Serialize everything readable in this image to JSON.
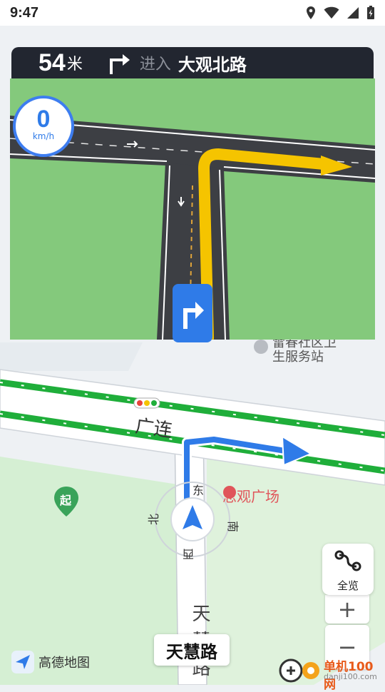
{
  "status_bar": {
    "time": "9:47"
  },
  "navigation": {
    "distance": "54",
    "distance_unit": "米",
    "action": "进入",
    "road_name": "大观北路"
  },
  "speed": {
    "value": "0",
    "unit": "km/h"
  },
  "map": {
    "poi_siguan": "思观广场",
    "poi_service_line1": "雷春社区卫",
    "poi_service_line2": "生服务站",
    "road_guanglian": "广连",
    "road_tianhui_vertical": "天慧路",
    "compass": {
      "east": "东",
      "south": "南",
      "west": "西",
      "north": "北"
    },
    "start_marker": "起"
  },
  "controls": {
    "overview_label": "全览",
    "zoom_in": "+",
    "zoom_out": "−"
  },
  "current_road": "天慧路",
  "logo_text": "高德地图",
  "watermark": {
    "title": "单机100网",
    "url": "danji100.com"
  },
  "colors": {
    "nav_panel": "#222630",
    "route_blue": "#2f7be8",
    "green_road": "#1fae3a",
    "grass": "#84c97c",
    "turn_yellow": "#f5c400"
  }
}
